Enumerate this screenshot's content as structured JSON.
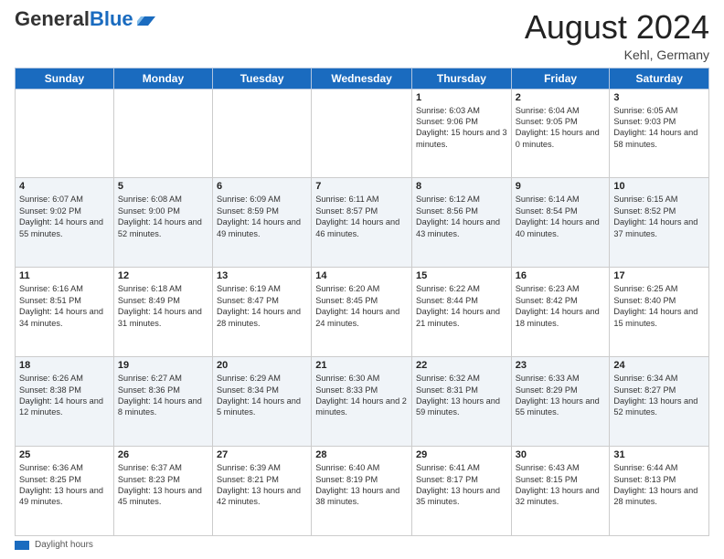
{
  "header": {
    "logo_general": "General",
    "logo_blue": "Blue",
    "month_title": "August 2024",
    "location": "Kehl, Germany"
  },
  "days_of_week": [
    "Sunday",
    "Monday",
    "Tuesday",
    "Wednesday",
    "Thursday",
    "Friday",
    "Saturday"
  ],
  "footer": {
    "label": "Daylight hours"
  },
  "weeks": [
    [
      {
        "day": "",
        "info": ""
      },
      {
        "day": "",
        "info": ""
      },
      {
        "day": "",
        "info": ""
      },
      {
        "day": "",
        "info": ""
      },
      {
        "day": "1",
        "info": "Sunrise: 6:03 AM\nSunset: 9:06 PM\nDaylight: 15 hours\nand 3 minutes."
      },
      {
        "day": "2",
        "info": "Sunrise: 6:04 AM\nSunset: 9:05 PM\nDaylight: 15 hours\nand 0 minutes."
      },
      {
        "day": "3",
        "info": "Sunrise: 6:05 AM\nSunset: 9:03 PM\nDaylight: 14 hours\nand 58 minutes."
      }
    ],
    [
      {
        "day": "4",
        "info": "Sunrise: 6:07 AM\nSunset: 9:02 PM\nDaylight: 14 hours\nand 55 minutes."
      },
      {
        "day": "5",
        "info": "Sunrise: 6:08 AM\nSunset: 9:00 PM\nDaylight: 14 hours\nand 52 minutes."
      },
      {
        "day": "6",
        "info": "Sunrise: 6:09 AM\nSunset: 8:59 PM\nDaylight: 14 hours\nand 49 minutes."
      },
      {
        "day": "7",
        "info": "Sunrise: 6:11 AM\nSunset: 8:57 PM\nDaylight: 14 hours\nand 46 minutes."
      },
      {
        "day": "8",
        "info": "Sunrise: 6:12 AM\nSunset: 8:56 PM\nDaylight: 14 hours\nand 43 minutes."
      },
      {
        "day": "9",
        "info": "Sunrise: 6:14 AM\nSunset: 8:54 PM\nDaylight: 14 hours\nand 40 minutes."
      },
      {
        "day": "10",
        "info": "Sunrise: 6:15 AM\nSunset: 8:52 PM\nDaylight: 14 hours\nand 37 minutes."
      }
    ],
    [
      {
        "day": "11",
        "info": "Sunrise: 6:16 AM\nSunset: 8:51 PM\nDaylight: 14 hours\nand 34 minutes."
      },
      {
        "day": "12",
        "info": "Sunrise: 6:18 AM\nSunset: 8:49 PM\nDaylight: 14 hours\nand 31 minutes."
      },
      {
        "day": "13",
        "info": "Sunrise: 6:19 AM\nSunset: 8:47 PM\nDaylight: 14 hours\nand 28 minutes."
      },
      {
        "day": "14",
        "info": "Sunrise: 6:20 AM\nSunset: 8:45 PM\nDaylight: 14 hours\nand 24 minutes."
      },
      {
        "day": "15",
        "info": "Sunrise: 6:22 AM\nSunset: 8:44 PM\nDaylight: 14 hours\nand 21 minutes."
      },
      {
        "day": "16",
        "info": "Sunrise: 6:23 AM\nSunset: 8:42 PM\nDaylight: 14 hours\nand 18 minutes."
      },
      {
        "day": "17",
        "info": "Sunrise: 6:25 AM\nSunset: 8:40 PM\nDaylight: 14 hours\nand 15 minutes."
      }
    ],
    [
      {
        "day": "18",
        "info": "Sunrise: 6:26 AM\nSunset: 8:38 PM\nDaylight: 14 hours\nand 12 minutes."
      },
      {
        "day": "19",
        "info": "Sunrise: 6:27 AM\nSunset: 8:36 PM\nDaylight: 14 hours\nand 8 minutes."
      },
      {
        "day": "20",
        "info": "Sunrise: 6:29 AM\nSunset: 8:34 PM\nDaylight: 14 hours\nand 5 minutes."
      },
      {
        "day": "21",
        "info": "Sunrise: 6:30 AM\nSunset: 8:33 PM\nDaylight: 14 hours\nand 2 minutes."
      },
      {
        "day": "22",
        "info": "Sunrise: 6:32 AM\nSunset: 8:31 PM\nDaylight: 13 hours\nand 59 minutes."
      },
      {
        "day": "23",
        "info": "Sunrise: 6:33 AM\nSunset: 8:29 PM\nDaylight: 13 hours\nand 55 minutes."
      },
      {
        "day": "24",
        "info": "Sunrise: 6:34 AM\nSunset: 8:27 PM\nDaylight: 13 hours\nand 52 minutes."
      }
    ],
    [
      {
        "day": "25",
        "info": "Sunrise: 6:36 AM\nSunset: 8:25 PM\nDaylight: 13 hours\nand 49 minutes."
      },
      {
        "day": "26",
        "info": "Sunrise: 6:37 AM\nSunset: 8:23 PM\nDaylight: 13 hours\nand 45 minutes."
      },
      {
        "day": "27",
        "info": "Sunrise: 6:39 AM\nSunset: 8:21 PM\nDaylight: 13 hours\nand 42 minutes."
      },
      {
        "day": "28",
        "info": "Sunrise: 6:40 AM\nSunset: 8:19 PM\nDaylight: 13 hours\nand 38 minutes."
      },
      {
        "day": "29",
        "info": "Sunrise: 6:41 AM\nSunset: 8:17 PM\nDaylight: 13 hours\nand 35 minutes."
      },
      {
        "day": "30",
        "info": "Sunrise: 6:43 AM\nSunset: 8:15 PM\nDaylight: 13 hours\nand 32 minutes."
      },
      {
        "day": "31",
        "info": "Sunrise: 6:44 AM\nSunset: 8:13 PM\nDaylight: 13 hours\nand 28 minutes."
      }
    ]
  ]
}
